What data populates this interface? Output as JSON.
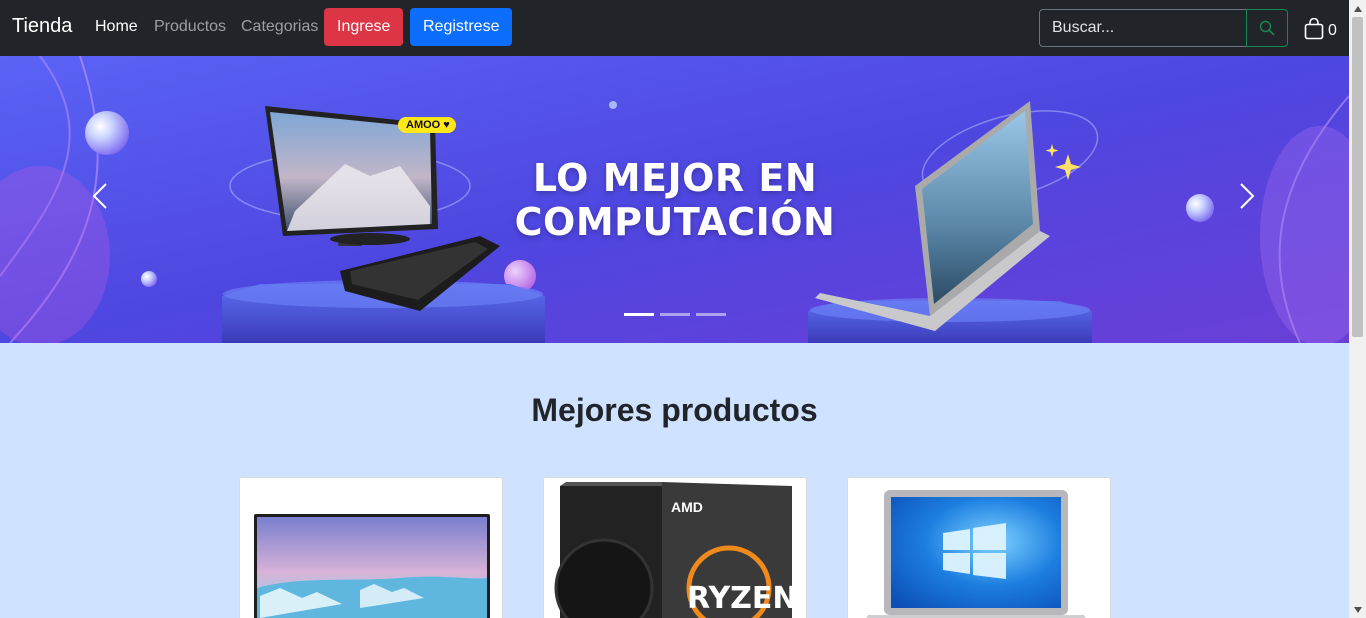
{
  "navbar": {
    "brand": "Tienda",
    "links": [
      {
        "label": "Home",
        "active": true
      },
      {
        "label": "Productos",
        "active": false
      },
      {
        "label": "Categorias",
        "active": false
      }
    ],
    "login_label": "Ingrese",
    "register_label": "Registrese",
    "search_placeholder": "Buscar...",
    "search_icon": "search-icon",
    "cart_icon": "shopping-bag-icon",
    "cart_count": "0"
  },
  "carousel": {
    "title_line1": "LO MEJOR EN",
    "title_line2": "COMPUTACIÓN",
    "badge": "AMOO ♥",
    "slide_count": 3,
    "active_slide": 1
  },
  "section": {
    "title": "Mejores productos",
    "products": [
      {
        "name": "monitor",
        "image": "monitor-image"
      },
      {
        "name": "ryzen-processor",
        "image": "processor-box-image",
        "box_brand": "AMD",
        "box_text": "RYZEN"
      },
      {
        "name": "laptop",
        "image": "laptop-image"
      }
    ]
  },
  "colors": {
    "navbar": "#212529",
    "page_bg": "#cfe2ff",
    "login": "#dc3545",
    "register": "#0d6efd",
    "search_border": "#198754"
  }
}
